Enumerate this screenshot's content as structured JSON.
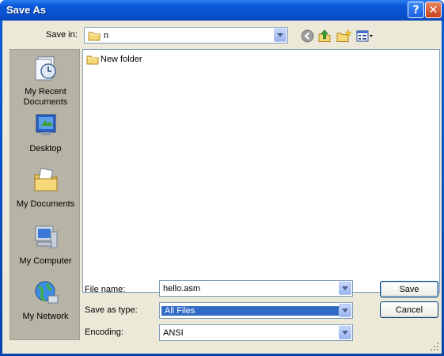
{
  "window": {
    "title": "Save As"
  },
  "titlebar": {
    "help_glyph": "?",
    "close_glyph": "✕"
  },
  "save_in": {
    "label": "Save in:",
    "value": "n"
  },
  "toolbar": {
    "back_icon": "back-arrow-icon",
    "up_icon": "up-folder-icon",
    "new_folder_icon": "new-folder-icon",
    "views_icon": "views-menu-icon"
  },
  "places": [
    {
      "label1": "My Recent",
      "label2": "Documents",
      "icon": "recent-documents-icon"
    },
    {
      "label1": "Desktop",
      "label2": "",
      "icon": "desktop-icon"
    },
    {
      "label1": "My Documents",
      "label2": "",
      "icon": "my-documents-icon"
    },
    {
      "label1": "My Computer",
      "label2": "",
      "icon": "my-computer-icon"
    },
    {
      "label1": "My Network",
      "label2": "",
      "icon": "my-network-icon"
    }
  ],
  "files": [
    {
      "name": "New folder",
      "icon": "folder-icon"
    }
  ],
  "file_name": {
    "label": "File name:",
    "value": "hello.asm"
  },
  "save_as_type": {
    "label": "Save as type:",
    "value": "All Files"
  },
  "encoding": {
    "label": "Encoding:",
    "value": "ANSI"
  },
  "buttons": {
    "save": "Save",
    "cancel": "Cancel"
  },
  "colors": {
    "titlebar": "#0a58d8",
    "dialog_bg": "#ece9d8",
    "selection": "#316ac5",
    "close": "#c4421d"
  }
}
